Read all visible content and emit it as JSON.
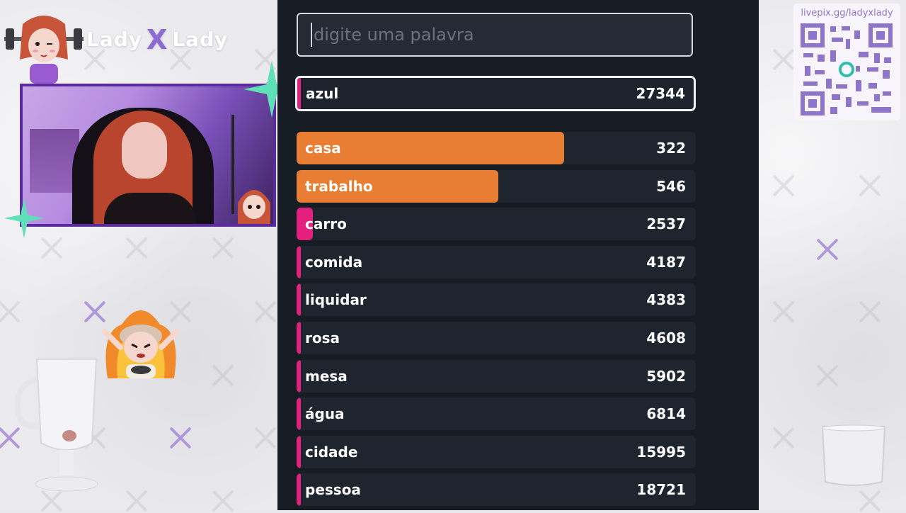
{
  "stream": {
    "logo": {
      "left": "Lady",
      "mark": "X",
      "right": "Lady"
    },
    "livepix_url": "livepix.gg/ladyxlady"
  },
  "game": {
    "search": {
      "placeholder": "digite uma palavra",
      "value": ""
    },
    "current_guess": {
      "word": "azul",
      "score": "27344"
    },
    "guesses": [
      {
        "word": "casa",
        "score": "322",
        "fill_fraction": 0.67,
        "color": "#e87d34"
      },
      {
        "word": "trabalho",
        "score": "546",
        "fill_fraction": 0.505,
        "color": "#e87d34"
      },
      {
        "word": "carro",
        "score": "2537",
        "fill_fraction": 0.04,
        "color": "#e4207f"
      },
      {
        "word": "comida",
        "score": "4187",
        "fill_fraction": 0.01,
        "color": "#e4207f"
      },
      {
        "word": "liquidar",
        "score": "4383",
        "fill_fraction": 0.01,
        "color": "#e4207f"
      },
      {
        "word": "rosa",
        "score": "4608",
        "fill_fraction": 0.01,
        "color": "#e4207f"
      },
      {
        "word": "mesa",
        "score": "5902",
        "fill_fraction": 0.01,
        "color": "#e4207f"
      },
      {
        "word": "água",
        "score": "6814",
        "fill_fraction": 0.01,
        "color": "#e4207f"
      },
      {
        "word": "cidade",
        "score": "15995",
        "fill_fraction": 0.01,
        "color": "#e4207f"
      },
      {
        "word": "pessoa",
        "score": "18721",
        "fill_fraction": 0.01,
        "color": "#e4207f"
      }
    ]
  },
  "colors": {
    "panel_bg": "#161c24",
    "row_bg": "#1e252e",
    "accent_purple": "#8d6ad4",
    "sparkle": "#5fe0b8"
  }
}
